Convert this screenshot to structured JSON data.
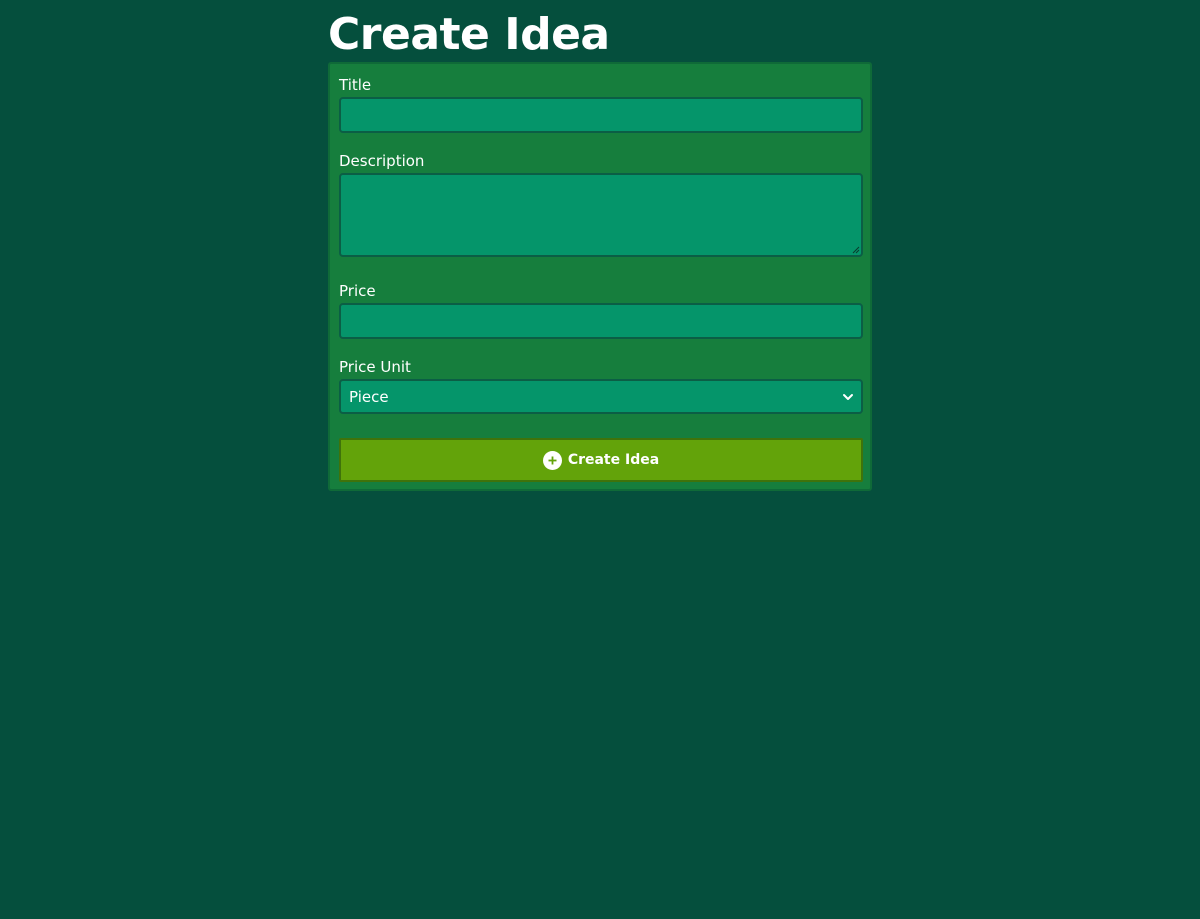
{
  "page": {
    "title": "Create Idea"
  },
  "form": {
    "title_label": "Title",
    "title_value": "",
    "description_label": "Description",
    "description_value": "",
    "price_label": "Price",
    "price_value": "",
    "price_unit_label": "Price Unit",
    "price_unit_selected": "Piece",
    "submit_label": "Create Idea"
  },
  "icons": {
    "submit_icon": "plus-circle-icon",
    "select_icon": "chevron-down-icon"
  },
  "colors": {
    "background": "#054f3d",
    "card": "#167e3d",
    "input": "#05956a",
    "button": "#63a30a"
  }
}
